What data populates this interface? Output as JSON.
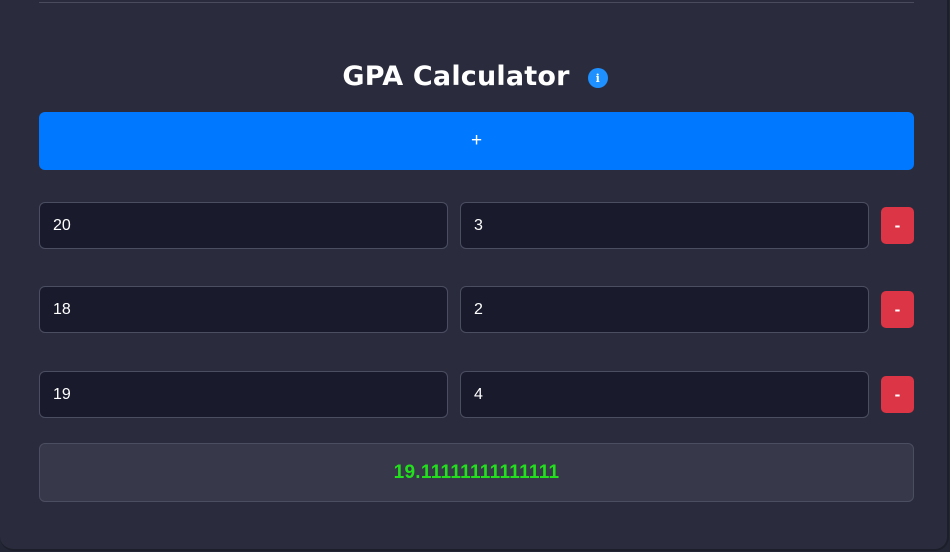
{
  "header": {
    "title": "GPA Calculator",
    "info_icon": "info-icon",
    "info_glyph": "i"
  },
  "add_button": {
    "label": "+"
  },
  "courses": [
    {
      "grade": "20",
      "credit": "3",
      "remove_label": "-"
    },
    {
      "grade": "18",
      "credit": "2",
      "remove_label": "-"
    },
    {
      "grade": "19",
      "credit": "4",
      "remove_label": "-"
    }
  ],
  "result": {
    "value": "19.11111111111111"
  },
  "colors": {
    "background": "#2a2c3e",
    "add_button": "#0078ff",
    "remove_button": "#dc3545",
    "result_text": "#22e01c",
    "info_icon": "#1e90ff"
  }
}
